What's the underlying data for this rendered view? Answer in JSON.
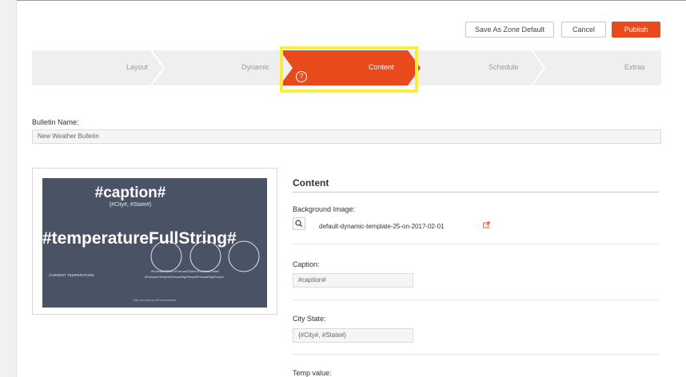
{
  "toolbar": {
    "save_zone_default_label": "Save As Zone Default",
    "cancel_label": "Cancel",
    "publish_label": "Publish"
  },
  "steps": [
    {
      "label": "Layout"
    },
    {
      "label": "Dynamic"
    },
    {
      "label": "Content",
      "active": true
    },
    {
      "label": "Schedule"
    },
    {
      "label": "Extras"
    }
  ],
  "help_icon_glyph": "?",
  "bulletin": {
    "label": "Bulletin Name:",
    "value": "New Weather Bulletin"
  },
  "preview": {
    "caption": "#caption#",
    "city_state": "{#City#, #State#}",
    "temperature": "#temperatureFullString#",
    "current_label": "CURRENT TEMPERATURE",
    "forecast_1": "#Forecast1Tilde#  #Forecast2Tilde#  #Forecast3Tilde#",
    "forecast_2": "#Forecast1Temper#ForecastHighTempr#ForecastHighTempr#",
    "credit": "Data provided by #ProviderName#"
  },
  "content": {
    "section_title": "Content",
    "background_label": "Background Image:",
    "background_value": "default-dynamic-template-25-on-2017-02-01",
    "caption_label": "Caption:",
    "caption_value": "#caption#",
    "city_state_label": "City State:",
    "city_state_value": "{#City#, #State#}",
    "temp_value_label": "Temp value:"
  },
  "colors": {
    "accent": "#e84a1c",
    "highlight": "#f6ee43",
    "step_bg": "#efefef",
    "preview_bg": "#4a5366"
  }
}
